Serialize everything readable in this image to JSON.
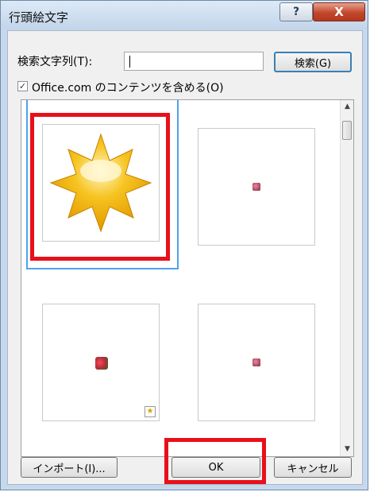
{
  "window": {
    "title": "行頭絵文字",
    "help_label": "?",
    "close_label": "X"
  },
  "search": {
    "label": "検索文字列(T):",
    "value": "",
    "button_label": "検索(G)"
  },
  "include_online": {
    "checked": true,
    "label": "Office.com のコンテンツを含める(O)"
  },
  "results": {
    "items": [
      {
        "kind": "sun",
        "selected": true
      },
      {
        "kind": "small-rose"
      },
      {
        "kind": "rose-with-star-badge"
      },
      {
        "kind": "small-rose"
      }
    ]
  },
  "footer": {
    "import_label": "インポート(I)...",
    "ok_label": "OK",
    "cancel_label": "キャンセル"
  },
  "colors": {
    "highlight_red": "#e8101a",
    "selection_blue": "#4da3f0"
  }
}
